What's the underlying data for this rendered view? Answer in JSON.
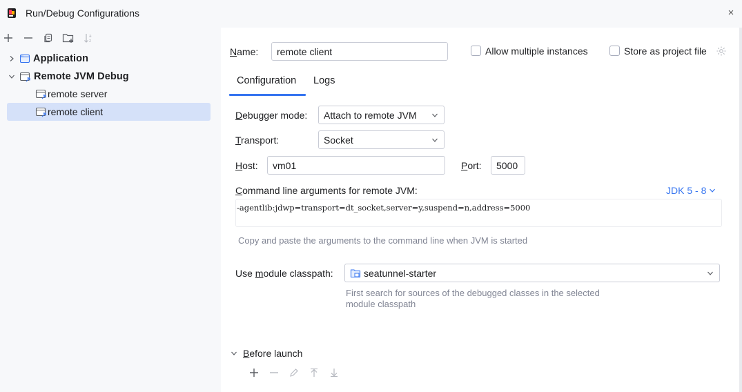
{
  "window": {
    "title": "Run/Debug Configurations",
    "close_glyph": "×"
  },
  "toolbar": {
    "add_icon": "plus-icon",
    "remove_icon": "minus-icon",
    "copy_icon": "copy-icon",
    "folder_icon": "new-folder-icon",
    "sort_icon": "sort-icon"
  },
  "tree": {
    "items": [
      {
        "label": "Application",
        "bold": true,
        "expanded": false
      },
      {
        "label": "Remote JVM Debug",
        "bold": true,
        "expanded": true
      },
      {
        "label": "remote server",
        "bold": false
      },
      {
        "label": "remote client",
        "bold": false,
        "selected": true
      }
    ]
  },
  "form": {
    "name_label": "Name:",
    "name_value": "remote client",
    "allow_multiple_label": "Allow multiple instances",
    "allow_multiple_checked": false,
    "store_project_label": "Store as project file",
    "store_project_checked": false,
    "tabs": [
      {
        "label": "Configuration",
        "active": true
      },
      {
        "label": "Logs",
        "active": false
      }
    ],
    "debugger_mode_label": "Debugger mode:",
    "debugger_mode_value": "Attach to remote JVM",
    "transport_label": "Transport:",
    "transport_value": "Socket",
    "host_label": "Host:",
    "host_value": "vm01",
    "port_label": "Port:",
    "port_value": "5000",
    "cmd_args_label": "Command line arguments for remote JVM:",
    "jdk_link": "JDK 5 - 8",
    "cmd_args_value": "-agentlib:jdwp=transport=dt_socket,server=y,suspend=n,address=5000",
    "cmd_args_hint": "Copy and paste the arguments to the command line when JVM is started",
    "module_label": "Use module classpath:",
    "module_value": "seatunnel-starter",
    "module_hint_line1": "First search for sources of the debugged classes in the selected",
    "module_hint_line2": "module classpath",
    "before_launch_label": "Before launch"
  },
  "colors": {
    "accent": "#3574f0",
    "selection": "#d5e1f9",
    "panel_bg": "#ffffff",
    "sidebar_bg": "#f7f8fa"
  }
}
